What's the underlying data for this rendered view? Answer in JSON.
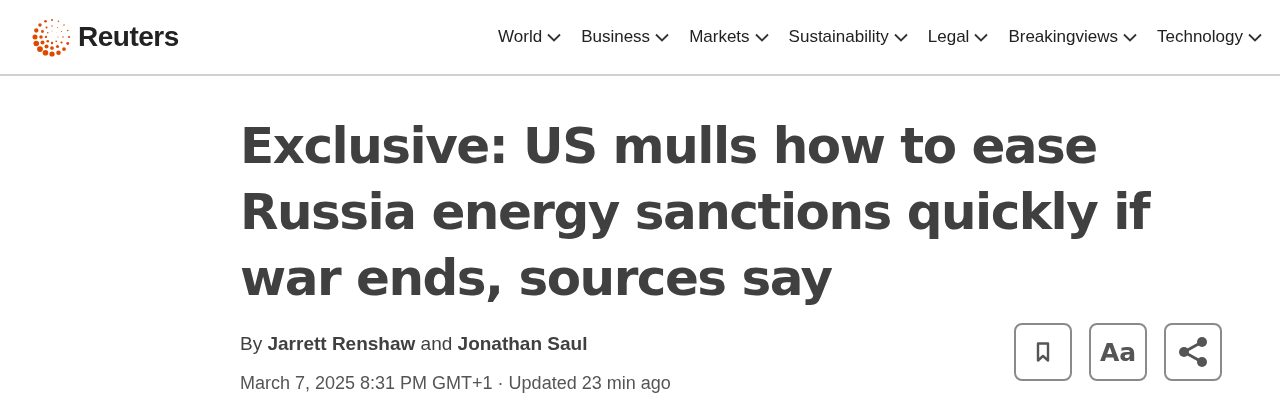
{
  "header": {
    "logo": "Reuters",
    "nav": [
      {
        "label": "World"
      },
      {
        "label": "Business"
      },
      {
        "label": "Markets"
      },
      {
        "label": "Sustainability"
      },
      {
        "label": "Legal"
      },
      {
        "label": "Breakingviews"
      },
      {
        "label": "Technology"
      }
    ]
  },
  "article": {
    "headline": "Exclusive: US mulls how to ease Russia energy sanctions quickly if war ends, sources say",
    "byline": "By **Jarrett Renshaw** and **Jonathan Saul**",
    "dateline": "March 7, 2025 8:31 PM GMT+1 · Updated 23 min ago",
    "tools": [
      {
        "kind": "bookmark"
      },
      {
        "kind": "text-size",
        "label": "Aa"
      },
      {
        "kind": "share"
      }
    ]
  }
}
